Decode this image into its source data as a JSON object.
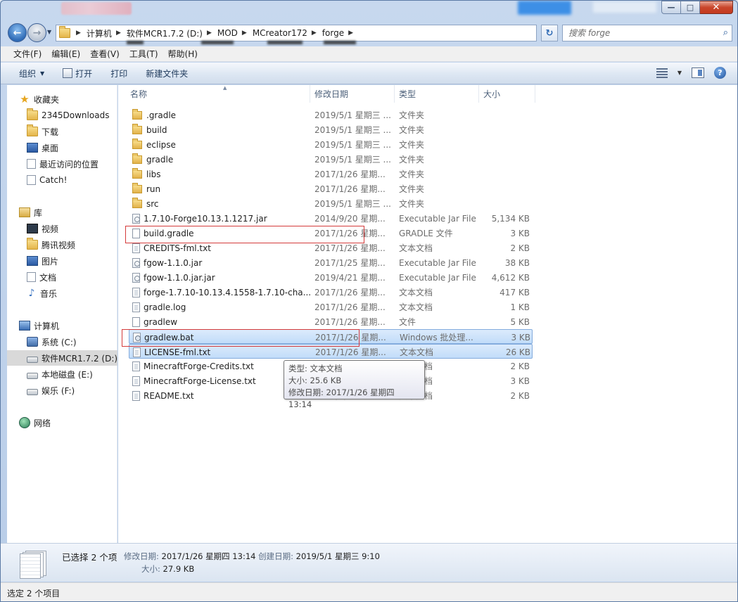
{
  "window": {
    "minimize_glyph": "—",
    "maximize_glyph": "□",
    "close_glyph": "✕"
  },
  "address": {
    "crumbs": [
      "计算机",
      "软件MCR1.7.2 (D:)",
      "MOD",
      "MCreator172",
      "forge"
    ],
    "search_placeholder": "搜索 forge"
  },
  "menu": [
    "文件(F)",
    "编辑(E)",
    "查看(V)",
    "工具(T)",
    "帮助(H)"
  ],
  "commands": {
    "organize": "组织",
    "open": "打开",
    "print": "打印",
    "new_folder": "新建文件夹"
  },
  "nav": {
    "favorites": {
      "label": "收藏夹",
      "items": [
        "2345Downloads",
        "下载",
        "桌面",
        "最近访问的位置",
        "Catch!"
      ]
    },
    "libraries": {
      "label": "库",
      "items": [
        "视频",
        "腾讯视频",
        "图片",
        "文档",
        "音乐"
      ]
    },
    "computer": {
      "label": "计算机",
      "items": [
        "系统 (C:)",
        "软件MCR1.7.2 (D:)",
        "本地磁盘 (E:)",
        "娱乐 (F:)"
      ]
    },
    "network": {
      "label": "网络"
    }
  },
  "columns": {
    "name": "名称",
    "date": "修改日期",
    "type": "类型",
    "size": "大小"
  },
  "files": [
    {
      "name": ".gradle",
      "date": "2019/5/1 星期三 ...",
      "type": "文件夹",
      "size": "",
      "kind": "folder"
    },
    {
      "name": "build",
      "date": "2019/5/1 星期三 ...",
      "type": "文件夹",
      "size": "",
      "kind": "folder"
    },
    {
      "name": "eclipse",
      "date": "2019/5/1 星期三 ...",
      "type": "文件夹",
      "size": "",
      "kind": "folder"
    },
    {
      "name": "gradle",
      "date": "2019/5/1 星期三 ...",
      "type": "文件夹",
      "size": "",
      "kind": "folder"
    },
    {
      "name": "libs",
      "date": "2017/1/26 星期...",
      "type": "文件夹",
      "size": "",
      "kind": "folder"
    },
    {
      "name": "run",
      "date": "2017/1/26 星期...",
      "type": "文件夹",
      "size": "",
      "kind": "folder"
    },
    {
      "name": "src",
      "date": "2019/5/1 星期三 ...",
      "type": "文件夹",
      "size": "",
      "kind": "folder"
    },
    {
      "name": "1.7.10-Forge10.13.1.1217.jar",
      "date": "2014/9/20 星期...",
      "type": "Executable Jar File",
      "size": "5,134 KB",
      "kind": "jar"
    },
    {
      "name": "build.gradle",
      "date": "2017/1/26 星期...",
      "type": "GRADLE 文件",
      "size": "3 KB",
      "kind": "file"
    },
    {
      "name": "CREDITS-fml.txt",
      "date": "2017/1/26 星期...",
      "type": "文本文档",
      "size": "2 KB",
      "kind": "txt"
    },
    {
      "name": "fgow-1.1.0.jar",
      "date": "2017/1/25 星期...",
      "type": "Executable Jar File",
      "size": "38 KB",
      "kind": "jar"
    },
    {
      "name": "fgow-1.1.0.jar.jar",
      "date": "2019/4/21 星期...",
      "type": "Executable Jar File",
      "size": "4,612 KB",
      "kind": "jar"
    },
    {
      "name": "forge-1.7.10-10.13.4.1558-1.7.10-cha...",
      "date": "2017/1/26 星期...",
      "type": "文本文档",
      "size": "417 KB",
      "kind": "txt"
    },
    {
      "name": "gradle.log",
      "date": "2017/1/26 星期...",
      "type": "文本文档",
      "size": "1 KB",
      "kind": "txt"
    },
    {
      "name": "gradlew",
      "date": "2017/1/26 星期...",
      "type": "文件",
      "size": "5 KB",
      "kind": "file"
    },
    {
      "name": "gradlew.bat",
      "date": "2017/1/26 星期...",
      "type": "Windows 批处理...",
      "size": "3 KB",
      "kind": "bat"
    },
    {
      "name": "LICENSE-fml.txt",
      "date": "2017/1/26 星期...",
      "type": "文本文档",
      "size": "26 KB",
      "kind": "txt"
    },
    {
      "name": "MinecraftForge-Credits.txt",
      "date": "2017/1/26 星期...",
      "type": "文本文档",
      "size": "2 KB",
      "kind": "txt"
    },
    {
      "name": "MinecraftForge-License.txt",
      "date": "2017/1/26 星期...",
      "type": "文本文档",
      "size": "3 KB",
      "kind": "txt"
    },
    {
      "name": "README.txt",
      "date": "2017/1/26 星期...",
      "type": "文本文档",
      "size": "2 KB",
      "kind": "txt"
    }
  ],
  "tooltip": {
    "line1": "类型: 文本文档",
    "line2": "大小: 25.6 KB",
    "line3": "修改日期: 2017/1/26 星期四 13:14"
  },
  "details": {
    "count": "已选择 2 个项",
    "modified_label": "修改日期:",
    "modified_value": "2017/1/26 星期四 13:14",
    "created_label": "创建日期:",
    "created_value": "2019/5/1 星期三 9:10",
    "size_label": "大小:",
    "size_value": "27.9 KB"
  },
  "status": "选定 2 个项目",
  "colors": {
    "selection": "#c1dcf9",
    "highlight_box": "#d43b3b",
    "accent": "#1e395b"
  }
}
